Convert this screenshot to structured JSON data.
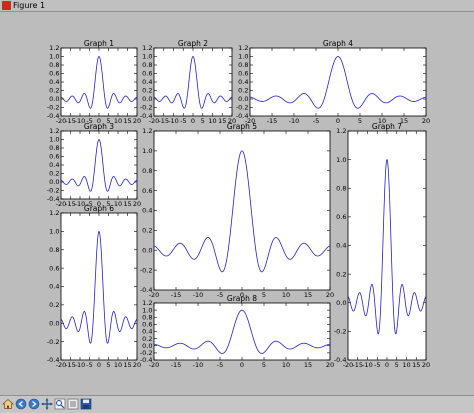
{
  "window": {
    "title": "Figure 1"
  },
  "toolbar": {
    "buttons": [
      "home-icon",
      "back-icon",
      "forward-icon",
      "pan-icon",
      "zoom-icon",
      "configure-icon",
      "save-icon"
    ]
  },
  "chart_data": [
    {
      "type": "line",
      "title": "Graph 1",
      "xlim": [
        -20,
        20
      ],
      "ylim": [
        -0.4,
        1.2
      ],
      "xticks": [
        "-20",
        "-15",
        "-10",
        "-5",
        "0",
        "5",
        "10",
        "15",
        "20"
      ],
      "yticks": [
        "-0.4",
        "-0.2",
        "0.0",
        "0.2",
        "0.4",
        "0.6",
        "0.8",
        "1.0",
        "1.2"
      ],
      "series": [
        {
          "color": "#2222cc",
          "function": "sin(x)/x",
          "x_range": [
            -20,
            20
          ]
        }
      ]
    },
    {
      "type": "line",
      "title": "Graph 2",
      "xlim": [
        -20,
        20
      ],
      "ylim": [
        -0.4,
        1.2
      ],
      "xticks": [
        "-20",
        "-15",
        "-10",
        "-5",
        "0",
        "5",
        "10",
        "15",
        "20"
      ],
      "yticks": [
        "-0.4",
        "-0.2",
        "0.0",
        "0.2",
        "0.4",
        "0.6",
        "0.8",
        "1.0",
        "1.2"
      ],
      "series": [
        {
          "color": "#2222cc",
          "function": "sin(x)/x",
          "x_range": [
            -20,
            20
          ]
        }
      ]
    },
    {
      "type": "line",
      "title": "Graph 4",
      "xlim": [
        -20,
        20
      ],
      "ylim": [
        -0.4,
        1.2
      ],
      "xticks": [
        "-20",
        "-15",
        "-10",
        "-5",
        "0",
        "5",
        "10",
        "15",
        "20"
      ],
      "yticks": [
        "-0.4",
        "-0.2",
        "0.0",
        "0.2",
        "0.4",
        "0.6",
        "0.8",
        "1.0",
        "1.2"
      ],
      "series": [
        {
          "color": "#2222cc",
          "function": "sin(x)/x",
          "x_range": [
            -20,
            20
          ]
        }
      ]
    },
    {
      "type": "line",
      "title": "Graph 3",
      "xlim": [
        -20,
        20
      ],
      "ylim": [
        -0.4,
        1.2
      ],
      "xticks": [
        "-20",
        "-15",
        "-10",
        "-5",
        "0",
        "5",
        "10",
        "15",
        "20"
      ],
      "yticks": [
        "-0.4",
        "-0.2",
        "0.0",
        "0.2",
        "0.4",
        "0.6",
        "0.8",
        "1.0",
        "1.2"
      ],
      "series": [
        {
          "color": "#2222cc",
          "function": "sin(x)/x",
          "x_range": [
            -20,
            20
          ]
        }
      ]
    },
    {
      "type": "line",
      "title": "Graph 5",
      "xlim": [
        -20,
        20
      ],
      "ylim": [
        -0.4,
        1.2
      ],
      "xticks": [
        "-20",
        "-15",
        "-10",
        "-5",
        "0",
        "5",
        "10",
        "15",
        "20"
      ],
      "yticks": [
        "-0.4",
        "-0.2",
        "0.0",
        "0.2",
        "0.4",
        "0.6",
        "0.8",
        "1.0",
        "1.2"
      ],
      "series": [
        {
          "color": "#2222cc",
          "function": "sin(x)/x",
          "x_range": [
            -20,
            20
          ]
        }
      ]
    },
    {
      "type": "line",
      "title": "Graph 7",
      "xlim": [
        -20,
        20
      ],
      "ylim": [
        -0.4,
        1.2
      ],
      "xticks": [
        "-20",
        "-15",
        "-10",
        "-5",
        "0",
        "5",
        "10",
        "15",
        "20"
      ],
      "yticks": [
        "-0.4",
        "-0.2",
        "0.0",
        "0.2",
        "0.4",
        "0.6",
        "0.8",
        "1.0",
        "1.2"
      ],
      "series": [
        {
          "color": "#2222cc",
          "function": "sin(x)/x",
          "x_range": [
            -20,
            20
          ]
        }
      ]
    },
    {
      "type": "line",
      "title": "Graph 6",
      "xlim": [
        -20,
        20
      ],
      "ylim": [
        -0.4,
        1.2
      ],
      "xticks": [
        "-20",
        "-15",
        "-10",
        "-5",
        "0",
        "5",
        "10",
        "15",
        "20"
      ],
      "yticks": [
        "-0.4",
        "-0.2",
        "0.0",
        "0.2",
        "0.4",
        "0.6",
        "0.8",
        "1.0",
        "1.2"
      ],
      "series": [
        {
          "color": "#2222cc",
          "function": "sin(x)/x",
          "x_range": [
            -20,
            20
          ]
        }
      ]
    },
    {
      "type": "line",
      "title": "Graph 8",
      "xlim": [
        -20,
        20
      ],
      "ylim": [
        -0.4,
        1.2
      ],
      "xticks": [
        "-20",
        "-15",
        "-10",
        "-5",
        "0",
        "5",
        "10",
        "15",
        "20"
      ],
      "yticks": [
        "-0.4",
        "-0.2",
        "0.0",
        "0.2",
        "0.4",
        "0.6",
        "0.8",
        "1.0",
        "1.2"
      ],
      "series": [
        {
          "color": "#2222cc",
          "function": "sin(x)/x",
          "x_range": [
            -20,
            20
          ]
        }
      ]
    }
  ]
}
